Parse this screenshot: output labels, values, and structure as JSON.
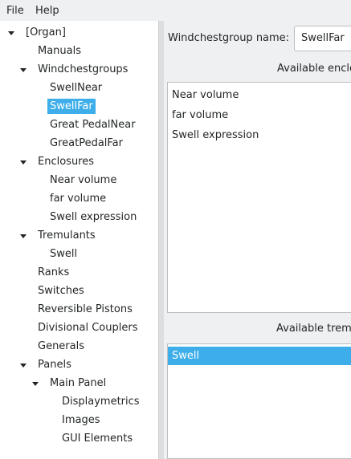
{
  "menubar": {
    "file_label": "File",
    "help_label": "Help"
  },
  "tree": {
    "organ": "[Organ]",
    "manuals": "Manuals",
    "windchestgroups": "Windchestgroups",
    "wcg_swellnear": "SwellNear",
    "wcg_swellfar": "SwellFar",
    "wcg_greatpedalnear": "Great PedalNear",
    "wcg_greatpedalfar": "GreatPedalFar",
    "enclosures": "Enclosures",
    "enc_near_volume": "Near volume",
    "enc_far_volume": "far volume",
    "enc_swell_expression": "Swell expression",
    "tremulants": "Tremulants",
    "trem_swell": "Swell",
    "ranks": "Ranks",
    "switches": "Switches",
    "reversible_pistons": "Reversible Pistons",
    "divisional_couplers": "Divisional Couplers",
    "generals": "Generals",
    "panels": "Panels",
    "main_panel": "Main Panel",
    "displaymetrics": "Displaymetrics",
    "images": "Images",
    "gui_elements": "GUI Elements"
  },
  "editor": {
    "name_label": "Windchestgroup name:",
    "name_value": "SwellFar",
    "enclosures_label": "Available enclo",
    "enclosures": [
      "Near volume",
      "far volume",
      "Swell expression"
    ],
    "tremulants_label": "Available tremu",
    "tremulants": [
      "Swell"
    ]
  },
  "colors": {
    "selection": "#3daee9",
    "background": "#eff0f1"
  }
}
